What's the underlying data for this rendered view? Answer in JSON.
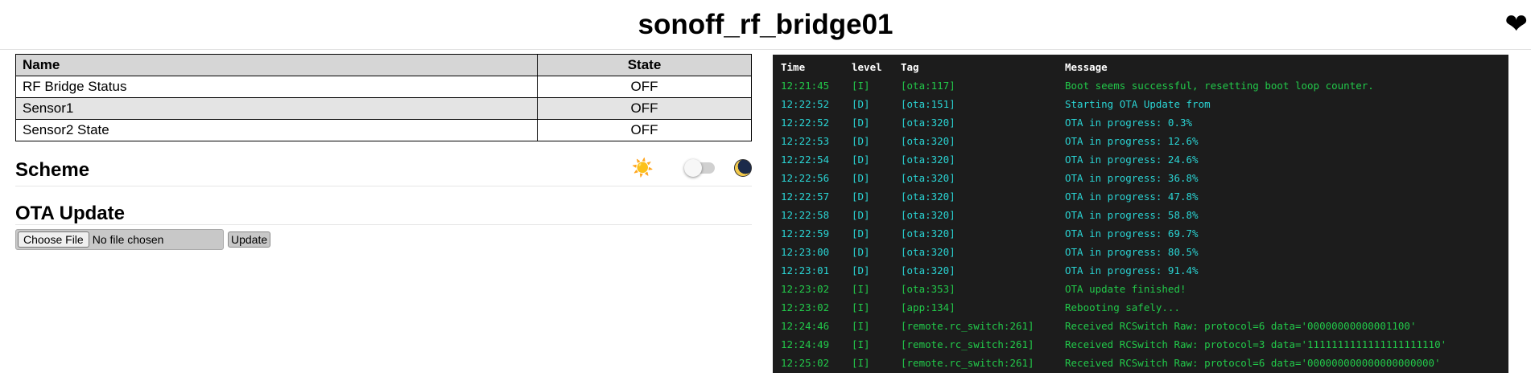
{
  "header": {
    "title": "sonoff_rf_bridge01",
    "heart_glyph": "❤"
  },
  "entities_table": {
    "columns": [
      "Name",
      "State"
    ],
    "rows": [
      {
        "name": "RF Bridge Status",
        "state": "OFF"
      },
      {
        "name": "Sensor1",
        "state": "OFF"
      },
      {
        "name": "Sensor2 State",
        "state": "OFF"
      }
    ]
  },
  "scheme": {
    "title": "Scheme",
    "sun_glyph": "☀️",
    "toggle_on": false
  },
  "ota": {
    "title": "OTA Update",
    "choose_file_label": "Choose File",
    "no_file_label": "No file chosen",
    "update_label": "Update"
  },
  "log": {
    "columns": [
      "Time",
      "level",
      "Tag",
      "Message"
    ],
    "colors": {
      "I": "#22c94a",
      "D": "#2ad4d4",
      "background": "#1c1c1c"
    },
    "entries": [
      {
        "time": "12:21:45",
        "level": "[I]",
        "tag": "[ota:117]",
        "message": "Boot seems successful, resetting boot loop counter."
      },
      {
        "time": "12:22:52",
        "level": "[D]",
        "tag": "[ota:151]",
        "message": "Starting OTA Update from"
      },
      {
        "time": "12:22:52",
        "level": "[D]",
        "tag": "[ota:320]",
        "message": "OTA in progress: 0.3%"
      },
      {
        "time": "12:22:53",
        "level": "[D]",
        "tag": "[ota:320]",
        "message": "OTA in progress: 12.6%"
      },
      {
        "time": "12:22:54",
        "level": "[D]",
        "tag": "[ota:320]",
        "message": "OTA in progress: 24.6%"
      },
      {
        "time": "12:22:56",
        "level": "[D]",
        "tag": "[ota:320]",
        "message": "OTA in progress: 36.8%"
      },
      {
        "time": "12:22:57",
        "level": "[D]",
        "tag": "[ota:320]",
        "message": "OTA in progress: 47.8%"
      },
      {
        "time": "12:22:58",
        "level": "[D]",
        "tag": "[ota:320]",
        "message": "OTA in progress: 58.8%"
      },
      {
        "time": "12:22:59",
        "level": "[D]",
        "tag": "[ota:320]",
        "message": "OTA in progress: 69.7%"
      },
      {
        "time": "12:23:00",
        "level": "[D]",
        "tag": "[ota:320]",
        "message": "OTA in progress: 80.5%"
      },
      {
        "time": "12:23:01",
        "level": "[D]",
        "tag": "[ota:320]",
        "message": "OTA in progress: 91.4%"
      },
      {
        "time": "12:23:02",
        "level": "[I]",
        "tag": "[ota:353]",
        "message": "OTA update finished!"
      },
      {
        "time": "12:23:02",
        "level": "[I]",
        "tag": "[app:134]",
        "message": "Rebooting safely..."
      },
      {
        "time": "12:24:46",
        "level": "[I]",
        "tag": "[remote.rc_switch:261]",
        "message": "Received RCSwitch Raw: protocol=6 data='00000000000001100'"
      },
      {
        "time": "12:24:49",
        "level": "[I]",
        "tag": "[remote.rc_switch:261]",
        "message": "Received RCSwitch Raw: protocol=3 data='1111111111111111111110'"
      },
      {
        "time": "12:25:02",
        "level": "[I]",
        "tag": "[remote.rc_switch:261]",
        "message": "Received RCSwitch Raw: protocol=6 data='000000000000000000000'"
      }
    ]
  }
}
